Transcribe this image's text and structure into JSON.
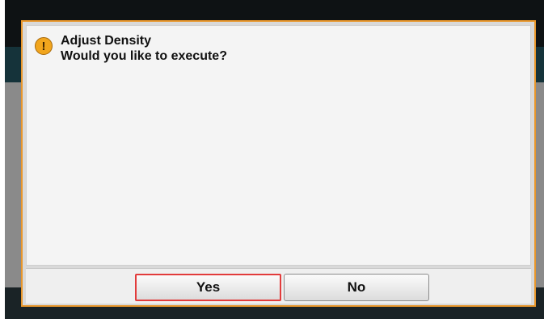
{
  "dialog": {
    "title": "Adjust Density",
    "message": "Would you like to execute?",
    "icon": "warning-icon",
    "icon_glyph": "!"
  },
  "buttons": {
    "yes_label": "Yes",
    "no_label": "No"
  },
  "colors": {
    "dialog_border": "#e8962a",
    "selected_button_border": "#e23b3b",
    "warning_icon": "#f1a51d"
  }
}
